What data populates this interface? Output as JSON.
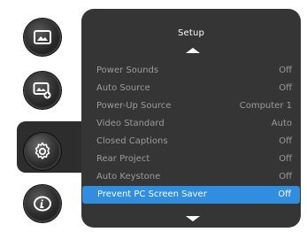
{
  "panel": {
    "title": "Setup"
  },
  "sidebar": {
    "icons": [
      {
        "name": "image-icon"
      },
      {
        "name": "image-plus-icon"
      },
      {
        "name": "gear-icon"
      },
      {
        "name": "info-icon"
      }
    ]
  },
  "menu": {
    "items": [
      {
        "label": "Power Sounds",
        "value": "Off"
      },
      {
        "label": "Auto Source",
        "value": "Off"
      },
      {
        "label": "Power-Up Source",
        "value": "Computer 1"
      },
      {
        "label": "Video Standard",
        "value": "Auto"
      },
      {
        "label": "Closed Captions",
        "value": "Off"
      },
      {
        "label": "Rear Project",
        "value": "Off"
      },
      {
        "label": "Auto Keystone",
        "value": "Off"
      },
      {
        "label": "Prevent PC Screen Saver",
        "value": "Off",
        "selected": true
      }
    ]
  },
  "colors": {
    "panel_bg": "#353535",
    "selected_bg": "#2f8ee0",
    "text_inactive": "#9b9b9b",
    "text_active": "#ffffff"
  }
}
